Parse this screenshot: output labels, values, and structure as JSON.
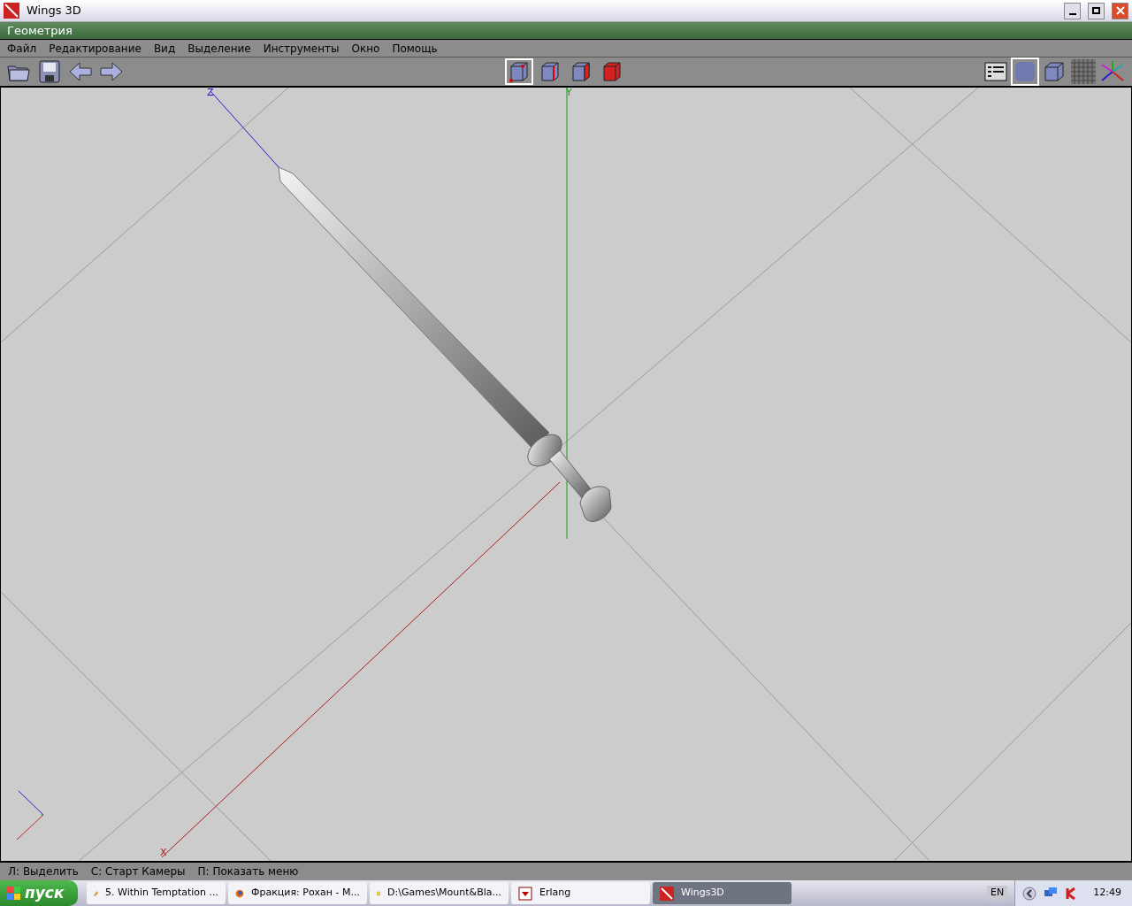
{
  "window": {
    "title": "Wings 3D"
  },
  "geometry_bar": {
    "title": "Геометрия"
  },
  "menu": [
    "Файл",
    "Редактирование",
    "Вид",
    "Выделение",
    "Инструменты",
    "Окно",
    "Помощь"
  ],
  "toolbar_left": [
    {
      "kind": "open"
    },
    {
      "kind": "save"
    },
    {
      "kind": "undo"
    },
    {
      "kind": "redo"
    }
  ],
  "select_modes": [
    {
      "kind": "vertex",
      "selected": true
    },
    {
      "kind": "edge",
      "selected": false
    },
    {
      "kind": "face",
      "selected": false
    },
    {
      "kind": "body",
      "selected": false
    }
  ],
  "view_buttons": [
    {
      "kind": "outliner",
      "selected": false
    },
    {
      "kind": "smooth",
      "selected": true
    },
    {
      "kind": "flat",
      "selected": false
    },
    {
      "kind": "groundplane",
      "selected": false
    },
    {
      "kind": "axes",
      "selected": false
    }
  ],
  "viewport": {
    "axis_labels": [
      {
        "kind": "z",
        "text": "Z"
      },
      {
        "kind": "y",
        "text": "Y"
      },
      {
        "kind": "x",
        "text": "X"
      }
    ]
  },
  "status_bar": [
    "Л: Выделить",
    "С: Старт Камеры",
    "П: Показать меню"
  ],
  "taskbar": {
    "start": "пуск",
    "tasks": [
      {
        "kind": "player",
        "label": "5. Within Temptation ...",
        "selected": false
      },
      {
        "kind": "browser",
        "label": "Фракция: Рохан - М...",
        "selected": false
      },
      {
        "kind": "folder",
        "label": "D:\\Games\\Mount&Bla...",
        "selected": false
      },
      {
        "kind": "erlang",
        "label": "Erlang",
        "selected": false
      },
      {
        "kind": "wings",
        "label": "Wings3D",
        "selected": true
      }
    ],
    "language": "EN",
    "clock": "12:49"
  }
}
